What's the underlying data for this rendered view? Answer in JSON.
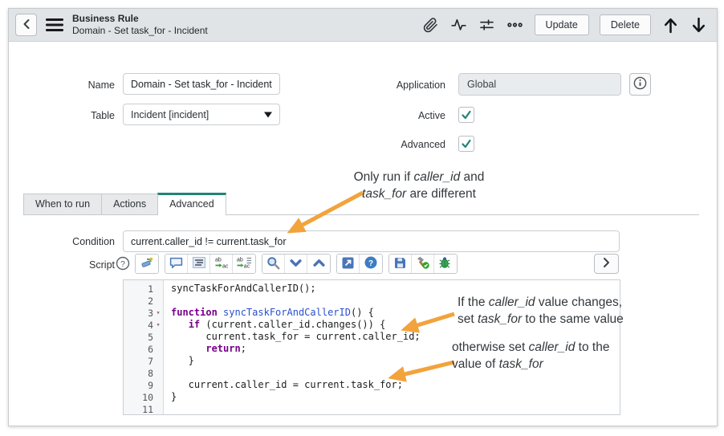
{
  "colors": {
    "accent": "#1f8476",
    "arrow": "#f2a33c",
    "keyword": "#770088",
    "definition": "#2a4fcf",
    "header_bg": "#e1e4e7"
  },
  "header": {
    "title_line1": "Business Rule",
    "title_line2": "Domain - Set task_for - Incident",
    "update_label": "Update",
    "delete_label": "Delete",
    "icons": [
      "back-icon",
      "context-menu-icon",
      "attachment-icon",
      "activity-icon",
      "filters-icon",
      "more-options-icon",
      "up-arrow-icon",
      "down-arrow-icon"
    ]
  },
  "form": {
    "name": {
      "label": "Name",
      "value": "Domain - Set task_for - Incident"
    },
    "table": {
      "label": "Table",
      "value": "Incident [incident]"
    },
    "application": {
      "label": "Application",
      "value": "Global"
    },
    "active": {
      "label": "Active",
      "checked": true
    },
    "advanced": {
      "label": "Advanced",
      "checked": true
    }
  },
  "tabs": [
    {
      "label": "When to run",
      "active": false
    },
    {
      "label": "Actions",
      "active": false
    },
    {
      "label": "Advanced",
      "active": true
    }
  ],
  "condition": {
    "label": "Condition",
    "value": "current.caller_id != current.task_for"
  },
  "script": {
    "label": "Script",
    "help_icon": "question-circle-icon",
    "toolbar_groups": [
      [
        "syntax-editor"
      ],
      [
        "toggle-comment",
        "format-code",
        "replace",
        "replace-all"
      ],
      [
        "search",
        "find-next",
        "find-previous"
      ],
      [
        "open-popout",
        "help"
      ],
      [
        "save",
        "syntax-check",
        "debug"
      ]
    ],
    "expand_label": ">",
    "fold_lines": [
      3,
      4
    ],
    "code_lines": [
      [
        {
          "t": "syncTaskForAndCallerID();"
        }
      ],
      [],
      [
        {
          "t": "function",
          "c": "kw"
        },
        {
          "t": " "
        },
        {
          "t": "syncTaskForAndCallerID",
          "c": "def"
        },
        {
          "t": "() {"
        }
      ],
      [
        {
          "t": "   "
        },
        {
          "t": "if",
          "c": "kw"
        },
        {
          "t": " (current.caller_id.changes()) {"
        }
      ],
      [
        {
          "t": "      current.task_for = current.caller_id;"
        }
      ],
      [
        {
          "t": "      "
        },
        {
          "t": "return",
          "c": "kw"
        },
        {
          "t": ";"
        }
      ],
      [
        {
          "t": "   }"
        }
      ],
      [],
      [
        {
          "t": "   current.caller_id = current.task_for;"
        }
      ],
      [
        {
          "t": "}"
        }
      ],
      []
    ]
  },
  "annotations": [
    {
      "lines": [
        [
          {
            "t": "Only run if "
          },
          {
            "t": "caller_id",
            "i": true
          },
          {
            "t": " and"
          }
        ],
        [
          {
            "t": "task_for",
            "i": true
          },
          {
            "t": " are different"
          }
        ]
      ]
    },
    {
      "lines": [
        [
          {
            "t": "If the "
          },
          {
            "t": "caller_id",
            "i": true
          },
          {
            "t": " value changes,"
          }
        ],
        [
          {
            "t": "set "
          },
          {
            "t": "task_for",
            "i": true
          },
          {
            "t": " to the same value"
          }
        ]
      ]
    },
    {
      "lines": [
        [
          {
            "t": "otherwise set "
          },
          {
            "t": "caller_id",
            "i": true
          },
          {
            "t": " to the"
          }
        ],
        [
          {
            "t": "value of "
          },
          {
            "t": "task_for",
            "i": true
          }
        ]
      ]
    }
  ]
}
